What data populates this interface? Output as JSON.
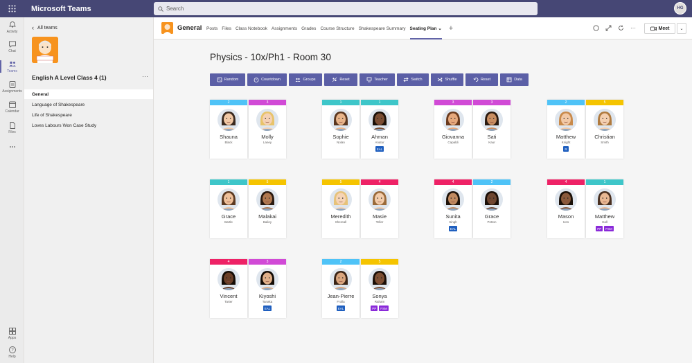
{
  "app": {
    "name": "Microsoft Teams",
    "search_placeholder": "Search",
    "user_initials": "HG"
  },
  "rail": [
    {
      "label": "Activity",
      "icon": "bell-icon"
    },
    {
      "label": "Chat",
      "icon": "chat-icon"
    },
    {
      "label": "Teams",
      "icon": "teams-icon",
      "active": true
    },
    {
      "label": "Assignments",
      "icon": "assignments-icon"
    },
    {
      "label": "Calendar",
      "icon": "calendar-icon"
    },
    {
      "label": "Files",
      "icon": "files-icon"
    },
    {
      "label": "...",
      "icon": "more-icon"
    },
    {
      "label": "Apps",
      "icon": "apps-icon"
    },
    {
      "label": "Help",
      "icon": "help-icon"
    }
  ],
  "team": {
    "back_label": "All teams",
    "name": "English A Level Class 4 (1)",
    "more": "···",
    "channels": [
      "General",
      "Language of Shakespeare",
      "Life of Shakespeare",
      "Loves Labours Won Case Study"
    ]
  },
  "header": {
    "channel": "General",
    "tabs": [
      "Posts",
      "Files",
      "Class Notebook",
      "Assignments",
      "Grades",
      "Course Structure",
      "Shakespeare Summary",
      "Seating Plan ⌄"
    ],
    "active_tab": 7,
    "plus": "+",
    "meet_label": "Meet",
    "meet_dropdown": "⌄"
  },
  "seating": {
    "title": "Physics - 10x/Ph1 - Room 30",
    "toolbar": [
      {
        "label": "Random",
        "icon": "random-icon"
      },
      {
        "label": "Countdown",
        "icon": "timer-icon"
      },
      {
        "label": "Groups",
        "icon": "groups-icon"
      },
      {
        "label": "Reset",
        "icon": "reset-people-icon"
      },
      {
        "label": "Teacher",
        "icon": "teacher-icon"
      },
      {
        "label": "Switch",
        "icon": "switch-icon"
      },
      {
        "label": "Shuffle",
        "icon": "shuffle-icon"
      },
      {
        "label": "Reset",
        "icon": "undo-icon"
      },
      {
        "label": "Data",
        "icon": "data-icon"
      }
    ],
    "colors": {
      "1": "#3ec6c9",
      "2": "#4fc3f7",
      "3": "#d14ad6",
      "4": "#ee2266",
      "5": "#f5c400"
    },
    "tag_colors": {
      "EAL": "#1f5fbf",
      "PP": "#8a2ad9",
      "FSM": "#8a2ad9",
      "SEN": "#1f5fbf"
    },
    "students": [
      {
        "group": "2",
        "first": "Shauna",
        "last": "Black",
        "tags": [],
        "skin": "#f1c8a5",
        "hair": "#3b2a1f"
      },
      {
        "group": "3",
        "first": "Molly",
        "last": "Laney",
        "tags": [],
        "skin": "#f5d1b3",
        "hair": "#e8c36a"
      },
      {
        "group": "1",
        "first": "Sophie",
        "last": "Nolan",
        "tags": [],
        "skin": "#e8b48a",
        "hair": "#5a3720"
      },
      {
        "group": "1",
        "first": "Ahman",
        "last": "Anatur",
        "tags": [
          "EAL"
        ],
        "skin": "#7a4d32",
        "hair": "#1a1008"
      },
      {
        "group": "3",
        "first": "Giovanna",
        "last": "Capaldi",
        "tags": [],
        "skin": "#e6a87c",
        "hair": "#6b3b1e"
      },
      {
        "group": "3",
        "first": "Sati",
        "last": "Kaur",
        "tags": [],
        "skin": "#c98e62",
        "hair": "#2a1a10"
      },
      {
        "group": "2",
        "first": "Matthew",
        "last": "Knight",
        "tags": [
          "R"
        ],
        "skin": "#f2c9a6",
        "hair": "#c98a4a"
      },
      {
        "group": "5",
        "first": "Christian",
        "last": "Smith",
        "tags": [],
        "skin": "#f4cfb0",
        "hair": "#b07a3e"
      },
      {
        "group": "1",
        "first": "Grace",
        "last": "Bartle",
        "tags": [],
        "skin": "#efc09a",
        "hair": "#5c3a22"
      },
      {
        "group": "5",
        "first": "Malakai",
        "last": "Bailey",
        "tags": [],
        "skin": "#b07850",
        "hair": "#2a1a10"
      },
      {
        "group": "5",
        "first": "Meredith",
        "last": "Shereall",
        "tags": [],
        "skin": "#f6d4b6",
        "hair": "#e6c27a"
      },
      {
        "group": "4",
        "first": "Masie",
        "last": "Teller",
        "tags": [],
        "skin": "#f3ccaa",
        "hair": "#9a6a3a"
      },
      {
        "group": "4",
        "first": "Sunita",
        "last": "Singh",
        "tags": [
          "EAL"
        ],
        "skin": "#c18a60",
        "hair": "#1f130a"
      },
      {
        "group": "2",
        "first": "Grace",
        "last": "Petton",
        "tags": [],
        "skin": "#6e4630",
        "hair": "#1a0f08"
      },
      {
        "group": "4",
        "first": "Mason",
        "last": "Ives",
        "tags": [],
        "skin": "#8a5a3c",
        "hair": "#1a1008"
      },
      {
        "group": "1",
        "first": "Matthew",
        "last": "Hall",
        "tags": [
          "PP",
          "FSM"
        ],
        "skin": "#e9b893",
        "hair": "#4a3020"
      },
      {
        "group": "4",
        "first": "Vincent",
        "last": "Tarter",
        "tags": [],
        "skin": "#6a3f28",
        "hair": "#140c06"
      },
      {
        "group": "3",
        "first": "Kiyoshi",
        "last": "Tanaka",
        "tags": [
          "EAL"
        ],
        "skin": "#e0b08a",
        "hair": "#140c06"
      },
      {
        "group": "2",
        "first": "Jean-Pierre",
        "last": "Frolla",
        "tags": [
          "EAL"
        ],
        "skin": "#d9a57e",
        "hair": "#3a2416"
      },
      {
        "group": "5",
        "first": "Sonya",
        "last": "Raham",
        "tags": [
          "PP",
          "FSM"
        ],
        "skin": "#7d4f33",
        "hair": "#1a0f08"
      }
    ]
  }
}
